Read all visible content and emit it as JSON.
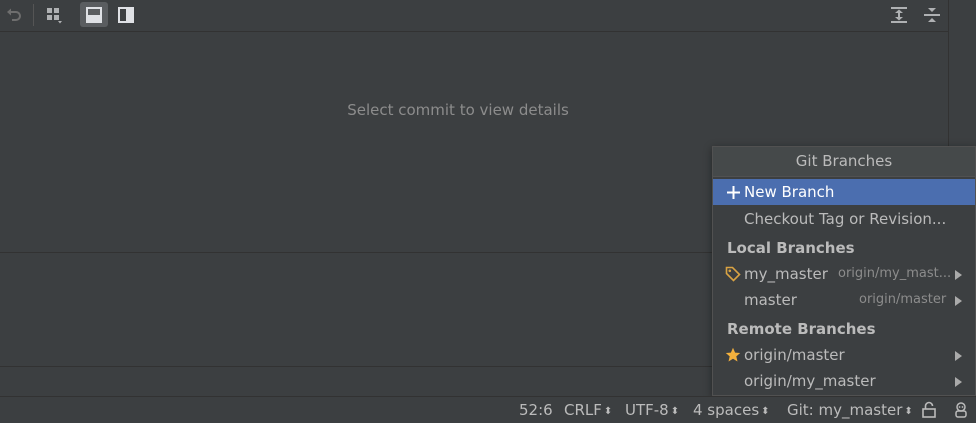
{
  "toolbar": {
    "icons": [
      "undo-icon",
      "group-by-icon",
      "layout-horizontal-icon",
      "layout-vertical-icon",
      "expand-all-icon",
      "collapse-all-icon"
    ]
  },
  "details": {
    "empty_text": "Select commit to view details"
  },
  "popup": {
    "title": "Git Branches",
    "new_branch": "New Branch",
    "checkout_tag": "Checkout Tag or Revision...",
    "local_header": "Local Branches",
    "remote_header": "Remote Branches",
    "local_branches": [
      {
        "name": "my_master",
        "tracking": "origin/my_mast...",
        "icon": "tag-icon"
      },
      {
        "name": "master",
        "tracking": "origin/master",
        "icon": ""
      }
    ],
    "remote_branches": [
      {
        "name": "origin/master",
        "icon": "star-icon"
      },
      {
        "name": "origin/my_master",
        "icon": ""
      }
    ]
  },
  "status": {
    "position": "52:6",
    "line_sep": "CRLF",
    "encoding": "UTF-8",
    "indent": "4 spaces",
    "branch": "Git: my_master"
  },
  "colors": {
    "background": "#3c3f41",
    "selection": "#4b6eaf",
    "star": "#f4b13d",
    "tag": "#d9a343"
  }
}
